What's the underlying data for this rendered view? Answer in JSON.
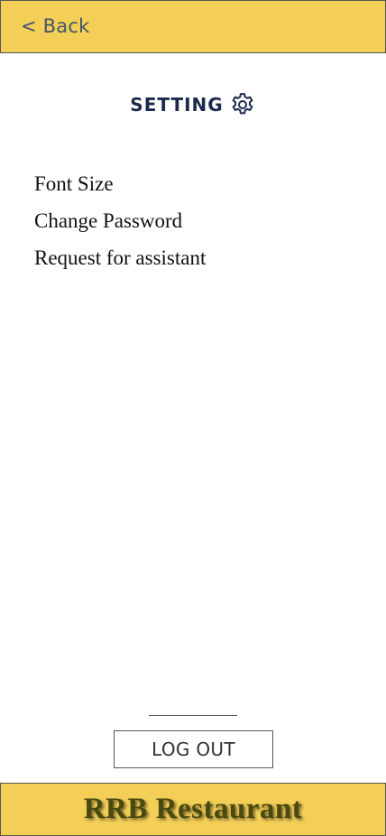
{
  "header": {
    "back_label": "< Back"
  },
  "title": {
    "text": "SETTING",
    "icon": "gear-icon"
  },
  "menu": {
    "items": [
      {
        "label": "Font Size"
      },
      {
        "label": "Change Password"
      },
      {
        "label": "Request for assistant"
      }
    ]
  },
  "logout": {
    "label": "LOG OUT"
  },
  "footer": {
    "brand": "RRB Restaurant"
  },
  "colors": {
    "bar_background": "#f4cf58",
    "title_color": "#1b2a4a",
    "brand_color": "#4a4a10"
  }
}
